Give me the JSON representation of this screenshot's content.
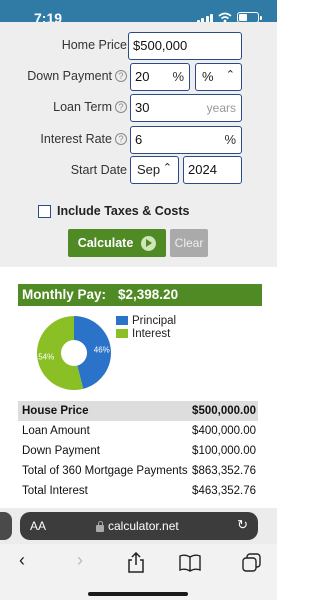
{
  "status_bar": {
    "time": "7:19"
  },
  "form": {
    "home_price": {
      "label": "Home Price",
      "value": "$500,000"
    },
    "down_payment": {
      "label": "Down Payment",
      "value": "20",
      "unit_suffix": "%",
      "unit_select": "%"
    },
    "loan_term": {
      "label": "Loan Term",
      "value": "30",
      "suffix": "years"
    },
    "interest_rate": {
      "label": "Interest Rate",
      "value": "6",
      "suffix": "%"
    },
    "start_date": {
      "label": "Start Date",
      "month": "Sep",
      "year": "2024"
    },
    "include_taxes": {
      "label": "Include Taxes & Costs",
      "checked": false
    },
    "calculate_label": "Calculate",
    "clear_label": "Clear"
  },
  "result": {
    "monthly_pay_label": "Monthly Pay:",
    "monthly_pay_value": "$2,398.20"
  },
  "chart_data": {
    "type": "pie",
    "categories": [
      "Principal",
      "Interest"
    ],
    "values": [
      46,
      54
    ],
    "value_labels": [
      "46%",
      "54%"
    ],
    "colors": [
      "#2b73c9",
      "#8ac025"
    ],
    "legend_placement": "right"
  },
  "summary_table": {
    "rows": [
      {
        "label": "House Price",
        "value": "$500,000.00"
      },
      {
        "label": "Loan Amount",
        "value": "$400,000.00"
      },
      {
        "label": "Down Payment",
        "value": "$100,000.00"
      },
      {
        "label": "Total of 360 Mortgage Payments",
        "value": "$863,352.76"
      },
      {
        "label": "Total Interest",
        "value": "$463,352.76"
      }
    ]
  },
  "browser": {
    "aa_label": "AA",
    "url": "calculator.net"
  }
}
